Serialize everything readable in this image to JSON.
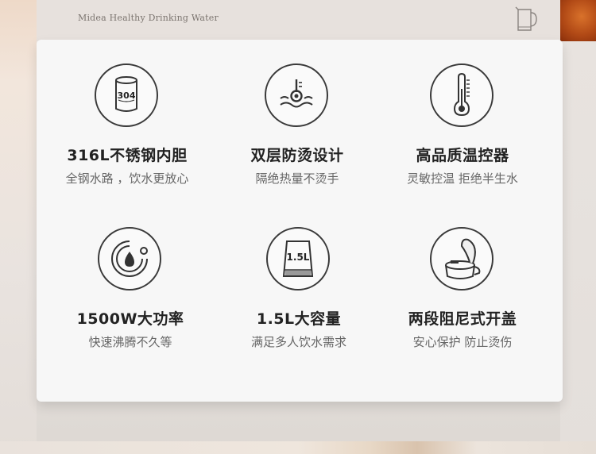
{
  "header": {
    "brand": "Midea Healthy Drinking Water"
  },
  "features": [
    {
      "title": "316L不锈钢内胆",
      "subtitle": "全钢水路 ，饮水更放心",
      "icon": "steel-304-icon",
      "icon_text": "304"
    },
    {
      "title": "双层防烫设计",
      "subtitle": "隔绝热量不烫手",
      "icon": "anti-scald-icon"
    },
    {
      "title": "高品质温控器",
      "subtitle": "灵敏控温 拒绝半生水",
      "icon": "thermometer-icon"
    },
    {
      "title": "1500W大功率",
      "subtitle": "快速沸腾不久等",
      "icon": "fast-boil-icon"
    },
    {
      "title": "1.5L大容量",
      "subtitle": "满足多人饮水需求",
      "icon": "capacity-icon",
      "icon_text": "1.5L"
    },
    {
      "title": "两段阻尼式开盖",
      "subtitle": "安心保护 防止烫伤",
      "icon": "damped-lid-icon"
    }
  ]
}
